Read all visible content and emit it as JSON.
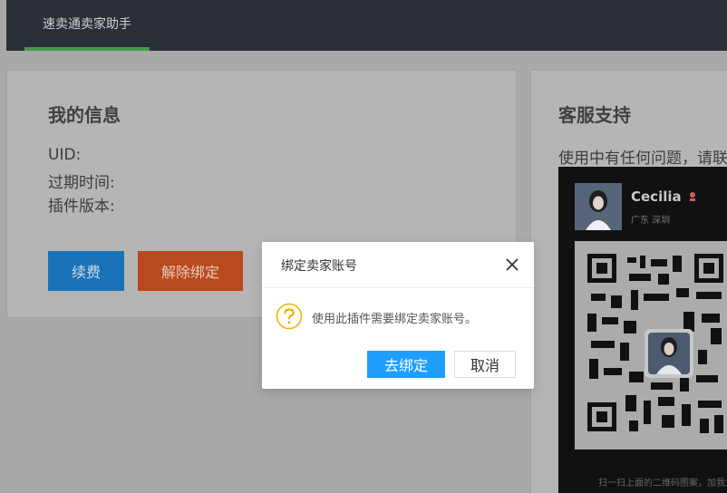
{
  "app": {
    "nav_tab": "速卖通卖家助手"
  },
  "info_card": {
    "title": "我的信息",
    "uid_label": "UID:",
    "expire_label": "过期时间:",
    "version_label": "插件版本:",
    "renew_button": "续费",
    "unbind_button": "解除绑定"
  },
  "support_card": {
    "title": "客服支持",
    "description": "使用中有任何问题，请联系",
    "profile": {
      "name": "Cecilia",
      "region": "广东 深圳"
    },
    "qr_caption": "扫一扫上面的二维码图案，加我为朋友。"
  },
  "dialog": {
    "title": "绑定卖家账号",
    "message": "使用此插件需要绑定卖家账号。",
    "confirm_button": "去绑定",
    "cancel_button": "取消"
  },
  "colors": {
    "accent_green": "#3f9c4b",
    "renew_blue": "#1a73b8",
    "unbind_orange": "#b84a1e",
    "dialog_blue": "#1e9fff",
    "question_yellow": "#f0b400"
  },
  "icons": {
    "close": "close-icon",
    "question": "question-circle-icon",
    "gender": "female-icon"
  }
}
